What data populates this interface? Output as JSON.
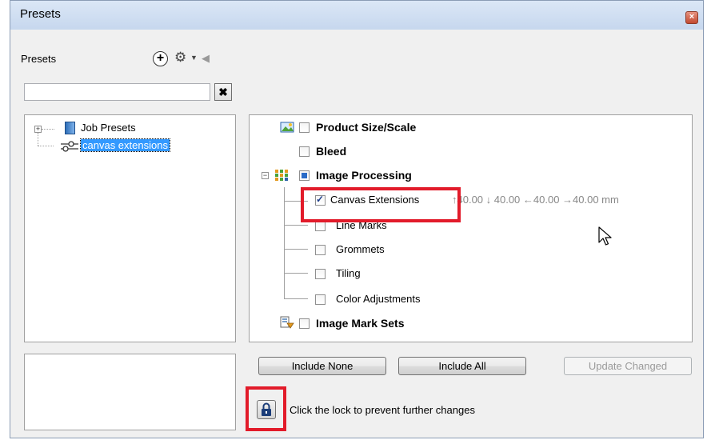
{
  "window": {
    "title": "Presets",
    "close_icon": "close-icon"
  },
  "presets_panel": {
    "heading": "Presets",
    "search": {
      "value": "",
      "placeholder": ""
    },
    "clear_label": "✖",
    "tree": [
      {
        "label": "Job Presets",
        "icon": "book-icon",
        "expanded": false
      },
      {
        "label": "canvas extensions",
        "icon": "sliders-icon",
        "selected": true
      }
    ]
  },
  "settings": {
    "items": [
      {
        "label": "Product Size/Scale",
        "checked": false,
        "bold": true
      },
      {
        "label": "Bleed",
        "checked": false,
        "bold": true
      },
      {
        "label": "Image Processing",
        "state": "partial",
        "bold": true
      },
      {
        "label": "Canvas Extensions",
        "checked": true,
        "dims": "↑40.00  ↓ 40.00  ←40.00  →40.00 mm"
      },
      {
        "label": "Line Marks",
        "checked": false
      },
      {
        "label": "Grommets",
        "checked": false
      },
      {
        "label": "Tiling",
        "checked": false
      },
      {
        "label": "Color Adjustments",
        "checked": false
      },
      {
        "label": "Image Mark Sets",
        "checked": false,
        "bold": true
      }
    ]
  },
  "buttons": {
    "include_none": "Include None",
    "include_all": "Include All",
    "update_changed": "Update Changed"
  },
  "lock": {
    "message": "Click the lock to prevent further changes",
    "icon": "lock-icon"
  },
  "colors": {
    "highlight_red": "#e21b2a",
    "selection_blue": "#3399ff"
  }
}
